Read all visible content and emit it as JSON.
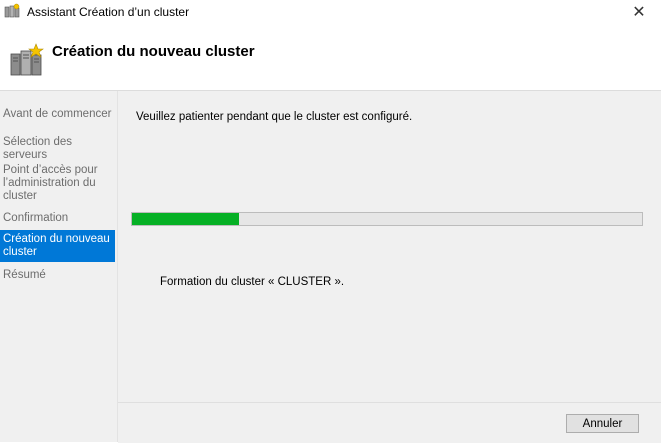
{
  "window": {
    "title": "Assistant Création d’un cluster",
    "close_glyph": "✕"
  },
  "header": {
    "title": "Création du nouveau cluster",
    "icon": "cluster-servers-icon"
  },
  "sidebar": {
    "items": [
      {
        "label": "Avant de commencer",
        "active": false
      },
      {
        "label": "Sélection des serveurs",
        "active": false
      },
      {
        "label": "Point d’accès pour l’administration du cluster",
        "active": false
      },
      {
        "label": "Confirmation",
        "active": false
      },
      {
        "label": "Création du nouveau cluster",
        "active": true
      },
      {
        "label": "Résumé",
        "active": false
      }
    ]
  },
  "main": {
    "message": "Veuillez patienter pendant que le cluster est configuré.",
    "progress_percent": 21,
    "status": "Formation du cluster « CLUSTER »."
  },
  "footer": {
    "cancel_label": "Annuler"
  },
  "colors": {
    "accent": "#0078d7",
    "progress": "#06b025"
  }
}
